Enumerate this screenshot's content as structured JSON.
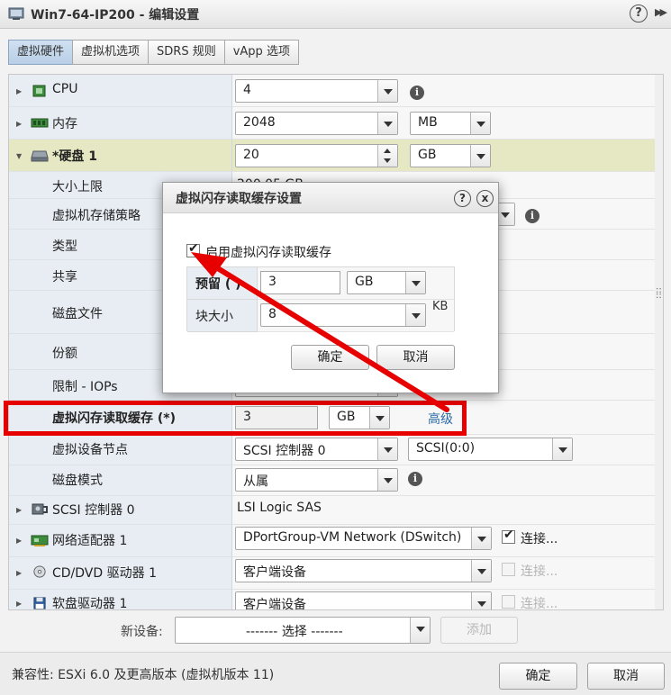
{
  "window": {
    "title": "Win7-64-IP200 - 编辑设置",
    "help": "?",
    "more": "▶▶"
  },
  "tabs": [
    {
      "label": "虚拟硬件",
      "active": true
    },
    {
      "label": "虚拟机选项"
    },
    {
      "label": "SDRS 规则"
    },
    {
      "label": "vApp 选项"
    }
  ],
  "rows": {
    "cpu": {
      "label": "CPU",
      "value": "4"
    },
    "memory": {
      "label": "内存",
      "value": "2048",
      "unit": "MB"
    },
    "disk": {
      "label": "*硬盘 1",
      "value": "20",
      "unit": "GB"
    },
    "max_size": {
      "label": "大小上限",
      "value": "200.05 GB"
    },
    "storage_policy": {
      "label": "虚拟机存储策略"
    },
    "type": {
      "label": "类型"
    },
    "share": {
      "label": "共享"
    },
    "disk_file": {
      "label": "磁盘文件"
    },
    "quota": {
      "label": "份额"
    },
    "limit_iops": {
      "label": "限制 - IOPs"
    },
    "flash_cache": {
      "label": "虚拟闪存读取缓存 (*)",
      "value": "3",
      "unit": "GB",
      "advanced": "高级"
    },
    "vdev_node": {
      "label": "虚拟设备节点",
      "controller": "SCSI 控制器 0",
      "slot": "SCSI(0:0)"
    },
    "disk_mode": {
      "label": "磁盘模式",
      "value": "从属"
    },
    "scsi": {
      "label": "SCSI 控制器 0",
      "value": "LSI Logic SAS"
    },
    "nic": {
      "label": "网络适配器 1",
      "value": "DPortGroup-VM Network (DSwitch)",
      "connect": "连接..."
    },
    "cdrom": {
      "label": "CD/DVD 驱动器 1",
      "value": "客户端设备",
      "connect": "连接..."
    },
    "floppy": {
      "label": "软盘驱动器 1",
      "value": "客户端设备",
      "connect": "连接..."
    }
  },
  "new_device": {
    "label": "新设备:",
    "select": "------- 选择 -------",
    "add": "添加"
  },
  "footer": {
    "compat": "兼容性: ESXi 6.0 及更高版本 (虚拟机版本 11)",
    "ok": "确定",
    "cancel": "取消"
  },
  "dialog": {
    "title": "虚拟闪存读取缓存设置",
    "help": "?",
    "close": "x",
    "enable_label": "启用虚拟闪存读取缓存",
    "reserve_label": "预留 ( )",
    "reserve_value": "3",
    "reserve_unit": "GB",
    "block_label": "块大小",
    "block_value": "8",
    "block_unit": "KB",
    "ok": "确定",
    "cancel": "取消"
  },
  "colors": {
    "highlight_box": "#e60000",
    "arrow": "#e60000",
    "active_tab": "#c4d8ec"
  }
}
